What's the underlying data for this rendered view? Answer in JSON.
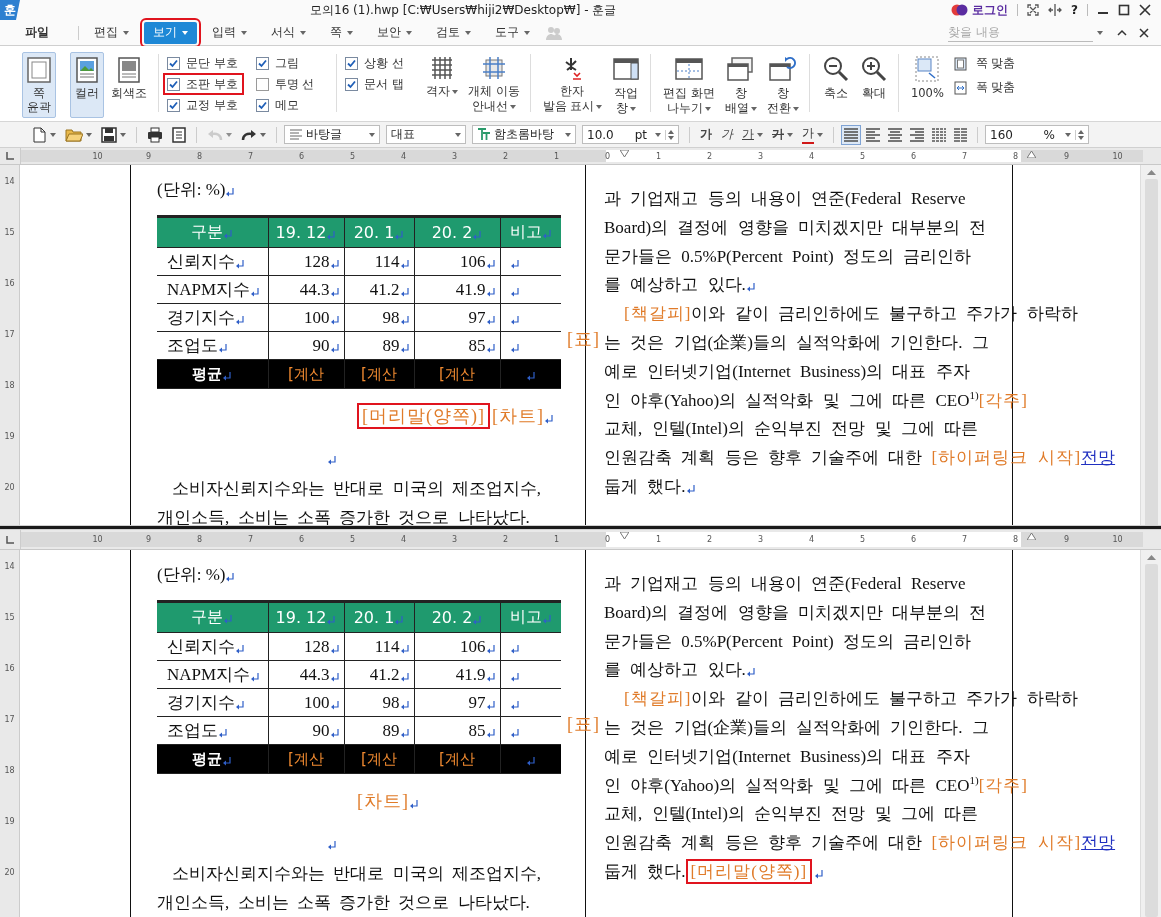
{
  "window": {
    "logo": "훈",
    "title": "모의16 (1).hwp [C:₩Users₩hiji2₩Desktop₩] - 훈글",
    "login": "로그인",
    "help": "?"
  },
  "menu": [
    {
      "label": "파일",
      "selected": false,
      "dropdown": false,
      "highlighted": false
    },
    {
      "label": "편집",
      "selected": false,
      "dropdown": true,
      "highlighted": false
    },
    {
      "label": "보기",
      "selected": true,
      "dropdown": true,
      "highlighted": true
    },
    {
      "label": "입력",
      "selected": false,
      "dropdown": true,
      "highlighted": false
    },
    {
      "label": "서식",
      "selected": false,
      "dropdown": true,
      "highlighted": false
    },
    {
      "label": "쪽",
      "selected": false,
      "dropdown": true,
      "highlighted": false
    },
    {
      "label": "보안",
      "selected": false,
      "dropdown": true,
      "highlighted": false
    },
    {
      "label": "검토",
      "selected": false,
      "dropdown": true,
      "highlighted": false
    },
    {
      "label": "도구",
      "selected": false,
      "dropdown": true,
      "highlighted": false
    }
  ],
  "search": {
    "placeholder": "찾을 내용"
  },
  "ribbon": {
    "view_buttons": [
      {
        "lines": [
          "쪽",
          "윤곽"
        ],
        "selected": true
      },
      {
        "lines": [
          "컬러"
        ],
        "selected": true
      },
      {
        "lines": [
          "회색조"
        ],
        "selected": false
      }
    ],
    "check_columns": [
      {
        "divider_before": false,
        "items": [
          {
            "label": "문단 부호",
            "checked": true,
            "highlighted": false
          },
          {
            "label": "조판 부호",
            "checked": true,
            "highlighted": true
          },
          {
            "label": "교정 부호",
            "checked": true,
            "highlighted": false
          }
        ]
      },
      {
        "divider_before": false,
        "items": [
          {
            "label": "그림",
            "checked": true,
            "highlighted": false
          },
          {
            "label": "투명 선",
            "checked": false,
            "highlighted": false
          },
          {
            "label": "메모",
            "checked": true,
            "highlighted": false
          }
        ]
      },
      {
        "divider_before": true,
        "items": [
          {
            "label": "상황 선",
            "checked": true,
            "highlighted": false
          },
          {
            "label": "문서 탭",
            "checked": true,
            "highlighted": false
          }
        ]
      }
    ],
    "tools": [
      {
        "lines": [
          "격자"
        ],
        "dropdown": true,
        "divider_before": false
      },
      {
        "lines": [
          "개체 이동",
          "안내선"
        ],
        "dropdown": true,
        "divider_before": false
      },
      {
        "lines": [
          "한자",
          "발음 표시"
        ],
        "dropdown": true,
        "divider_before": true
      },
      {
        "lines": [
          "작업",
          "창"
        ],
        "dropdown": true,
        "divider_before": false
      },
      {
        "lines": [
          "편집 화면",
          "나누기"
        ],
        "dropdown": true,
        "divider_before": true
      },
      {
        "lines": [
          "창",
          "배열"
        ],
        "dropdown": true,
        "divider_before": false
      },
      {
        "lines": [
          "창",
          "전환"
        ],
        "dropdown": true,
        "divider_before": false
      },
      {
        "lines": [
          "축소"
        ],
        "dropdown": false,
        "divider_before": true
      },
      {
        "lines": [
          "확대"
        ],
        "dropdown": false,
        "divider_before": false
      },
      {
        "lines": [
          "100%"
        ],
        "dropdown": false,
        "divider_before": true
      }
    ],
    "fit": [
      {
        "label": "쪽 맞춤"
      },
      {
        "label": "폭 맞춤"
      }
    ]
  },
  "toolbar": {
    "file_buttons": [
      {
        "dropdown": true,
        "divider_before": false,
        "disabled": false
      },
      {
        "dropdown": true,
        "divider_before": false,
        "disabled": false
      },
      {
        "dropdown": true,
        "divider_before": false,
        "disabled": false
      },
      {
        "dropdown": false,
        "divider_before": true,
        "disabled": false
      },
      {
        "dropdown": false,
        "divider_before": false,
        "disabled": false
      },
      {
        "dropdown": true,
        "divider_before": true,
        "disabled": true
      },
      {
        "dropdown": true,
        "divider_before": false,
        "disabled": false
      }
    ],
    "style": "바탕글",
    "language": "대표",
    "font": "함초롬바탕",
    "size": "10.0",
    "unit": "pt",
    "format": [
      {
        "text": "가",
        "kind": "bold",
        "dropdown": false
      },
      {
        "text": "가",
        "kind": "italic",
        "dropdown": false
      },
      {
        "text": "가",
        "kind": "underline",
        "dropdown": true
      },
      {
        "text": "가",
        "kind": "outline",
        "dropdown": true
      },
      {
        "text": "가",
        "kind": "color",
        "dropdown": true
      }
    ],
    "align": [
      {
        "kind": "justify",
        "selected": true
      },
      {
        "kind": "left",
        "selected": false
      },
      {
        "kind": "center",
        "selected": false
      },
      {
        "kind": "right",
        "selected": false
      },
      {
        "kind": "distribute",
        "selected": false
      },
      {
        "kind": "divide",
        "selected": false
      }
    ],
    "zoom": "160",
    "zoom_unit": "%"
  },
  "panes": [
    {
      "ruler": [
        "10",
        "9",
        "8",
        "7",
        "6",
        "5",
        "4",
        "3",
        "2",
        "1",
        "0",
        "1",
        "2",
        "3",
        "4",
        "5",
        "6",
        "7",
        "8",
        "9",
        "10"
      ],
      "vertical_ruler": [
        "14",
        "15",
        "16",
        "17",
        "18",
        "19",
        "20"
      ],
      "paragraph_marks": true,
      "left": {
        "unit": "(단위: %)",
        "table": {
          "columns": [
            "구분",
            "19. 12",
            "20. 1",
            "20. 2",
            "비고"
          ],
          "rows": [
            [
              "신뢰지수",
              "128",
              "114",
              "106"
            ],
            [
              "NAPM지수",
              "44.3",
              "41.2",
              "41.9"
            ],
            [
              "경기지수",
              "100",
              "98",
              "97"
            ],
            [
              "조업도",
              "90",
              "89",
              "85"
            ]
          ],
          "footer": [
            "평균",
            "[계산",
            "[계산",
            "[계산"
          ]
        },
        "table_marker": "[표]",
        "chart_line": [
          {
            "text": "[머리말(양쪽)]",
            "kind": "boxed_mark"
          },
          {
            "text": "[차트]",
            "kind": "mark"
          }
        ],
        "paragraph": [
          "소비자신뢰지수와는 반대로 미국의 제조업지수,",
          "개인소득, 소비는 소폭 증가한 것으로 나타났다."
        ]
      },
      "right": [
        {
          "indent": false,
          "lines": [
            [
              {
                "text": "과 기업재고 등의 내용이 연준(Federal Reserve",
                "kind": "plain"
              }
            ],
            [
              {
                "text": "Board)의 결정에 영향을 미치겠지만 대부분의 전",
                "kind": "plain"
              }
            ],
            [
              {
                "text": "문가들은 0.5%P(Percent Point) 정도의 금리인하",
                "kind": "plain"
              }
            ],
            [
              {
                "text": "를 예상하고 있다.",
                "kind": "plain"
              }
            ]
          ]
        },
        {
          "indent": true,
          "lines": [
            [
              {
                "text": "[책갈피]",
                "kind": "mark"
              },
              {
                "text": "이와 같이 금리인하에도 불구하고 주가가 하락하",
                "kind": "plain"
              }
            ],
            [
              {
                "text": "는 것은 기업(企業)들의 실적악화에 기인한다. 그",
                "kind": "plain"
              }
            ],
            [
              {
                "text": "예로 인터넷기업(Internet Business)의 대표 주자",
                "kind": "plain"
              }
            ],
            [
              {
                "text": "인 야후(Yahoo)의 실적악화 및 그에 따른 CEO",
                "kind": "plain"
              },
              {
                "text": "1)",
                "kind": "sup"
              },
              {
                "text": "[각주]",
                "kind": "mark"
              }
            ],
            [
              {
                "text": "교체, 인텔(Intel)의 순익부진 전망 및 그에 따른",
                "kind": "plain"
              }
            ],
            [
              {
                "text": "인원감축 계획 등은 향후 기술주에 대한 ",
                "kind": "plain"
              },
              {
                "text": "[하이퍼링크 시작]",
                "kind": "mark"
              },
              {
                "text": "전망",
                "kind": "link"
              }
            ],
            [
              {
                "text": "둡게 했다.",
                "kind": "plain"
              }
            ]
          ]
        }
      ]
    },
    {
      "ruler": [
        "10",
        "9",
        "8",
        "7",
        "6",
        "5",
        "4",
        "3",
        "2",
        "1",
        "0",
        "1",
        "2",
        "3",
        "4",
        "5",
        "6",
        "7",
        "8",
        "9",
        "10"
      ],
      "vertical_ruler": [
        "14",
        "15",
        "16",
        "17",
        "18",
        "19",
        "20"
      ],
      "paragraph_marks": true,
      "left": {
        "unit": "(단위: %)",
        "table": {
          "columns": [
            "구분",
            "19. 12",
            "20. 1",
            "20. 2",
            "비고"
          ],
          "rows": [
            [
              "신뢰지수",
              "128",
              "114",
              "106"
            ],
            [
              "NAPM지수",
              "44.3",
              "41.2",
              "41.9"
            ],
            [
              "경기지수",
              "100",
              "98",
              "97"
            ],
            [
              "조업도",
              "90",
              "89",
              "85"
            ]
          ],
          "footer": [
            "평균",
            "[계산",
            "[계산",
            "[계산"
          ]
        },
        "table_marker": "[표]",
        "chart_line": [
          {
            "text": "[차트]",
            "kind": "mark"
          }
        ],
        "paragraph": [
          "소비자신뢰지수와는 반대로 미국의 제조업지수,",
          "개인소득, 소비는 소폭 증가한 것으로 나타났다."
        ]
      },
      "right": [
        {
          "indent": false,
          "lines": [
            [
              {
                "text": "과 기업재고 등의 내용이 연준(Federal Reserve",
                "kind": "plain"
              }
            ],
            [
              {
                "text": "Board)의 결정에 영향을 미치겠지만 대부분의 전",
                "kind": "plain"
              }
            ],
            [
              {
                "text": "문가들은 0.5%P(Percent Point) 정도의 금리인하",
                "kind": "plain"
              }
            ],
            [
              {
                "text": "를 예상하고 있다.",
                "kind": "plain"
              }
            ]
          ]
        },
        {
          "indent": true,
          "lines": [
            [
              {
                "text": "[책갈피]",
                "kind": "mark"
              },
              {
                "text": "이와 같이 금리인하에도 불구하고 주가가 하락하",
                "kind": "plain"
              }
            ],
            [
              {
                "text": "는 것은 기업(企業)들의 실적악화에 기인한다. 그",
                "kind": "plain"
              }
            ],
            [
              {
                "text": "예로 인터넷기업(Internet Business)의 대표 주자",
                "kind": "plain"
              }
            ],
            [
              {
                "text": "인 야후(Yahoo)의 실적악화 및 그에 따른 CEO",
                "kind": "plain"
              },
              {
                "text": "1)",
                "kind": "sup"
              },
              {
                "text": "[각주]",
                "kind": "mark"
              }
            ],
            [
              {
                "text": "교체, 인텔(Intel)의 순익부진 전망 및 그에 따른",
                "kind": "plain"
              }
            ],
            [
              {
                "text": "인원감축 계획 등은 향후 기술주에 대한 ",
                "kind": "plain"
              },
              {
                "text": "[하이퍼링크 시작]",
                "kind": "mark"
              },
              {
                "text": "전망",
                "kind": "link"
              }
            ],
            [
              {
                "text": "둡게 했다.",
                "kind": "plain"
              },
              {
                "text": "[머리말(양쪽)]",
                "kind": "boxed_mark"
              }
            ]
          ]
        }
      ]
    }
  ]
}
